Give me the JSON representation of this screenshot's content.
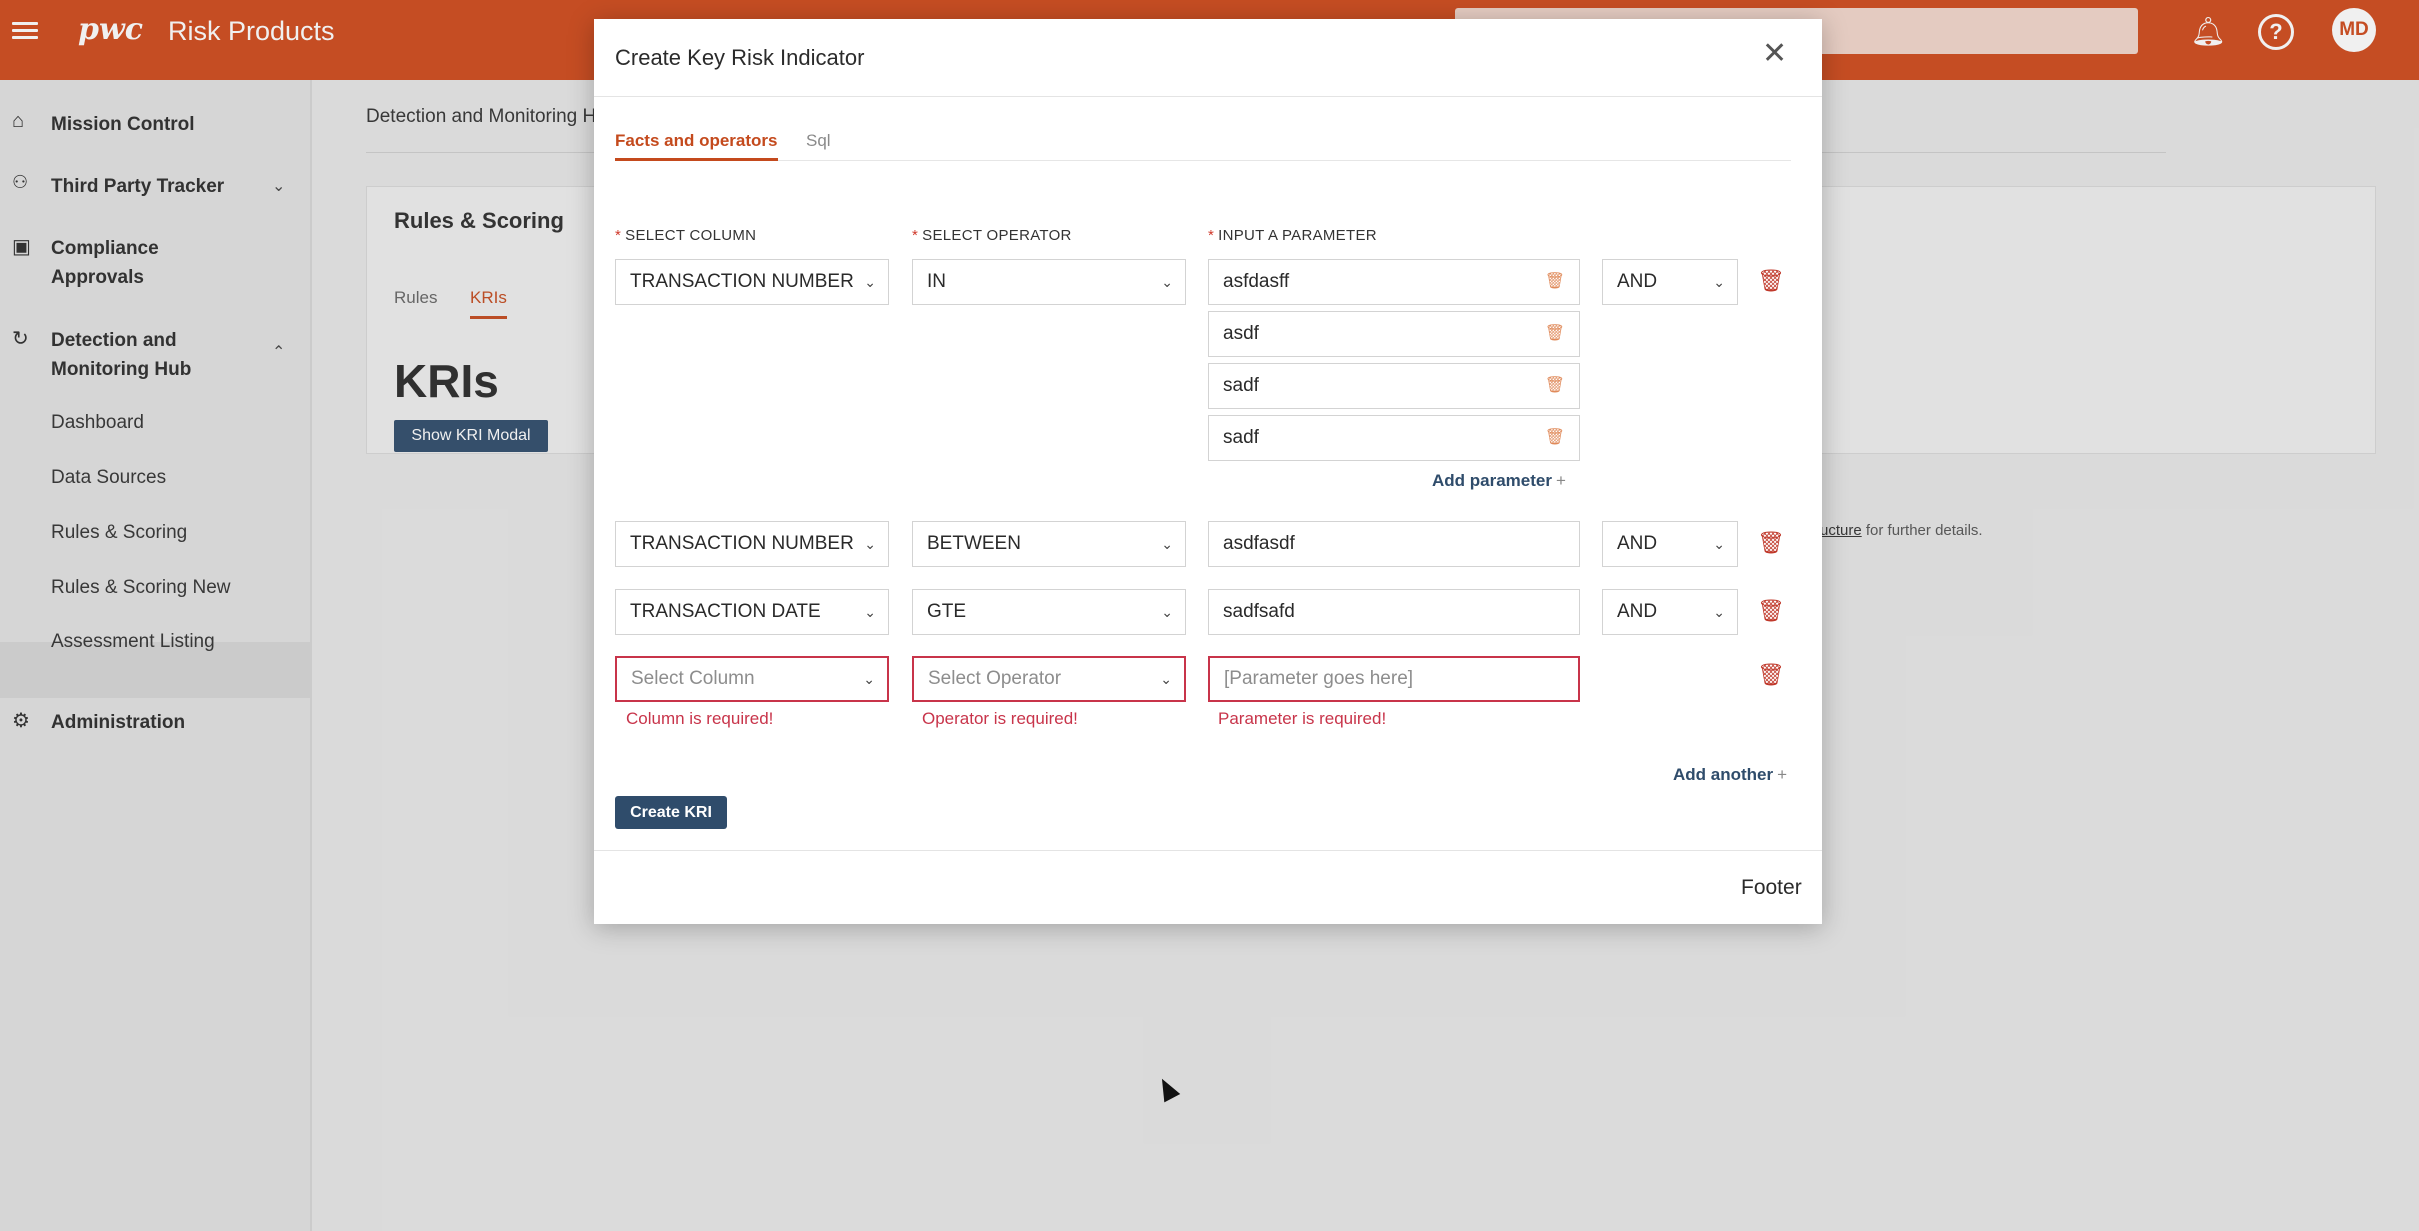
{
  "app": {
    "logo": "pwc",
    "name": "Risk Products",
    "avatar_initials": "MD",
    "accent": "#d04a1b"
  },
  "sidebar": {
    "items": [
      {
        "label": "Mission Control",
        "icon": "home-icon"
      },
      {
        "label": "Third Party Tracker",
        "icon": "people-icon"
      },
      {
        "label": "Compliance Approvals",
        "icon": "compliance-icon"
      },
      {
        "label": "Detection and Monitoring Hub",
        "icon": "refresh-icon"
      },
      {
        "label": "Administration",
        "icon": "gear-icon"
      }
    ],
    "sub_items": [
      "Dashboard",
      "Data Sources",
      "Rules & Scoring",
      "Rules & Scoring New",
      "Assessment Listing"
    ]
  },
  "page": {
    "breadcrumb": "Detection and Monitoring H",
    "card_title": "Rules & Scoring",
    "tabs": [
      "Rules",
      "KRIs"
    ],
    "heading": "KRIs",
    "show_modal_button": "Show KRI Modal",
    "note_link": "ucture",
    "note_text": "for further details."
  },
  "modal": {
    "title": "Create Key Risk Indicator",
    "tabs": [
      "Facts and operators",
      "Sql"
    ],
    "labels": {
      "column": "SELECT COLUMN",
      "operator": "SELECT OPERATOR",
      "parameter": "INPUT A PARAMETER",
      "required_mark": "*"
    },
    "rows": [
      {
        "column": "TRANSACTION NUMBER",
        "operator": "IN",
        "parameters": [
          "asfdasff",
          "asdf",
          "sadf",
          "sadf"
        ],
        "logic": "AND"
      },
      {
        "column": "TRANSACTION NUMBER",
        "operator": "BETWEEN",
        "parameters": [
          "asdfasdf"
        ],
        "logic": "AND"
      },
      {
        "column": "TRANSACTION DATE",
        "operator": "GTE",
        "parameters": [
          "sadfsafd"
        ],
        "logic": "AND"
      }
    ],
    "new_row": {
      "column_placeholder": "Select Column",
      "operator_placeholder": "Select Operator",
      "parameter_placeholder": "[Parameter goes here]",
      "column_error": "Column is required!",
      "operator_error": "Operator is required!",
      "parameter_error": "Parameter is required!"
    },
    "add_parameter": "Add parameter",
    "add_another": "Add another",
    "create_button": "Create KRI",
    "footer": "Footer"
  }
}
